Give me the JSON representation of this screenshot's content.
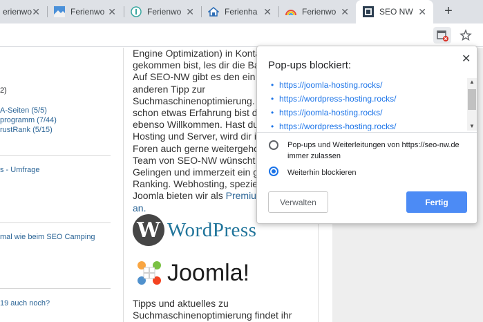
{
  "tabs": [
    {
      "title": "erienwo",
      "favicon": "generic-site-icon"
    },
    {
      "title": "Ferienwo",
      "favicon": "landscape-icon"
    },
    {
      "title": "Ferienwo",
      "favicon": "info-circle-icon"
    },
    {
      "title": "Ferienha",
      "favicon": "house-icon"
    },
    {
      "title": "Ferienwo",
      "favicon": "rainbow-icon"
    },
    {
      "title": "SEO NW",
      "favicon": "seo-nw-icon"
    }
  ],
  "close_glyph": "✕",
  "new_tab_glyph": "+",
  "sidebar": {
    "line1": "2)",
    "line2": "A-Seiten (5/5)",
    "line3": "programm (7/44)",
    "line4": "rustRank (5/15)",
    "line5": "s - Umfrage",
    "line6": "mal wie beim SEO Camping",
    "line7": "19 auch noch?"
  },
  "main": {
    "lines": [
      "Engine Optimization) in Kontakt",
      "gekommen bist, les dir die Ba",
      "Auf SEO-NW gibt es den ein",
      "anderen Tipp zur",
      "Suchmaschinenoptimierung.",
      "schon etwas Erfahrung bist d",
      "ebenso Willkommen. Hast du",
      "Hosting und Server, wird dir i",
      "Foren auch gerne weitergeho",
      "Team von SEO-NW wünscht",
      "Gelingen und immerzeit ein g",
      "Ranking. Webhosting, spezie",
      "Joomla bieten wir als "
    ],
    "link_text": "Premiu",
    "link_line2": "an.",
    "wordpress_logo_text": "WordPress",
    "joomla_logo_text": "Joomla!",
    "bottom_line1": "Tipps und aktuelles zu",
    "bottom_line2": "Suchmaschinenoptimierung findet ihr"
  },
  "popup": {
    "title": "Pop-ups blockiert:",
    "urls": [
      "https://joomla-hosting.rocks/",
      "https://wordpress-hosting.rocks/",
      "https://joomla-hosting.rocks/",
      "https://wordpress-hosting.rocks/"
    ],
    "option_allow": "Pop-ups und Weiterleitungen von https://seo-nw.de immer zulassen",
    "option_block": "Weiterhin blockieren",
    "selected_option": "block",
    "manage_label": "Verwalten",
    "done_label": "Fertig"
  },
  "colors": {
    "accent": "#1a73e8",
    "primary_button": "#4c8bf5",
    "link": "#2a6496"
  }
}
